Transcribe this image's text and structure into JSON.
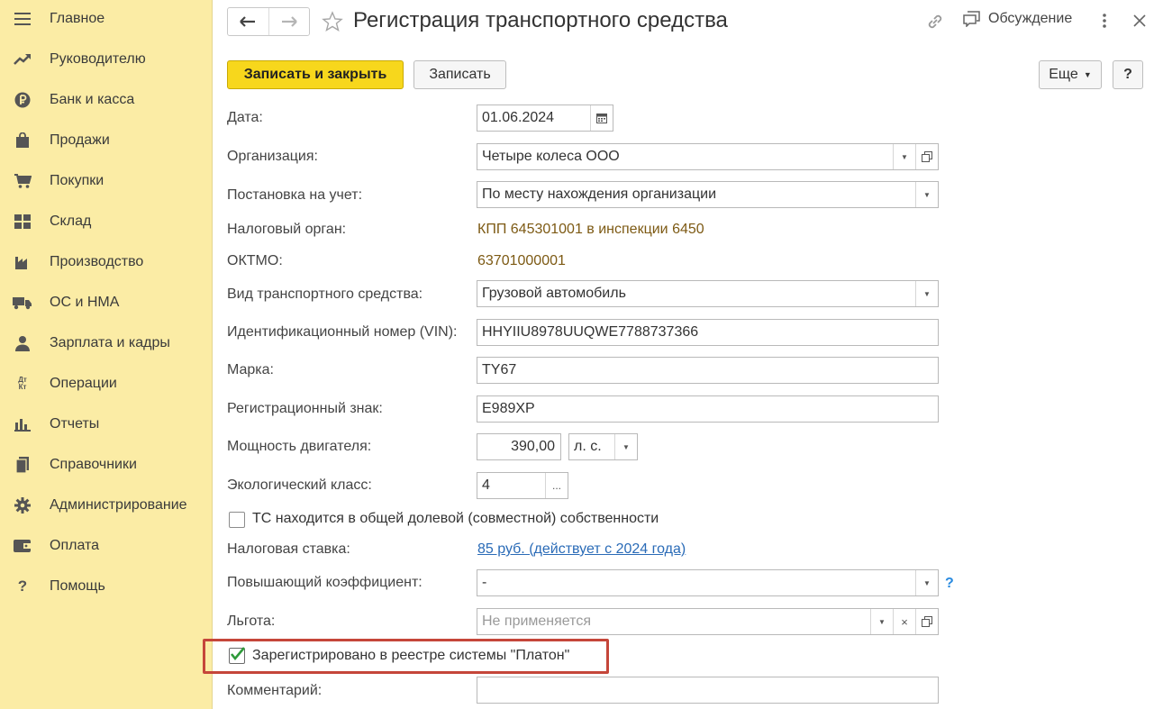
{
  "sidebar": {
    "items": [
      {
        "label": "Главное",
        "icon": "menu-icon"
      },
      {
        "label": "Руководителю",
        "icon": "trend-up-icon"
      },
      {
        "label": "Банк и касса",
        "icon": "ruble-coin-icon"
      },
      {
        "label": "Продажи",
        "icon": "shopping-bag-icon"
      },
      {
        "label": "Покупки",
        "icon": "cart-icon"
      },
      {
        "label": "Склад",
        "icon": "warehouse-grid-icon"
      },
      {
        "label": "Производство",
        "icon": "factory-icon"
      },
      {
        "label": "ОС и НМА",
        "icon": "truck-icon"
      },
      {
        "label": "Зарплата и кадры",
        "icon": "person-icon"
      },
      {
        "label": "Операции",
        "icon": "debit-credit-icon"
      },
      {
        "label": "Отчеты",
        "icon": "bar-chart-icon"
      },
      {
        "label": "Справочники",
        "icon": "books-icon"
      },
      {
        "label": "Администрирование",
        "icon": "gear-icon"
      },
      {
        "label": "Оплата",
        "icon": "wallet-icon"
      },
      {
        "label": "Помощь",
        "icon": "question-icon"
      }
    ],
    "debit_credit_glyph": "Дт Кт",
    "question_glyph": "?"
  },
  "header": {
    "title": "Регистрация транспортного средства",
    "discuss_label": "Обсуждение"
  },
  "toolbar": {
    "save_close_label": "Записать и закрыть",
    "save_label": "Записать",
    "more_label": "Еще",
    "help_label": "?"
  },
  "form": {
    "date": {
      "label": "Дата:",
      "value": "01.06.2024"
    },
    "organization": {
      "label": "Организация:",
      "value": "Четыре колеса ООО"
    },
    "registration": {
      "label": "Постановка на учет:",
      "value": "По месту нахождения организации"
    },
    "tax_authority": {
      "label": "Налоговый орган:",
      "value": "КПП 645301001 в инспекции 6450"
    },
    "oktmo": {
      "label": "ОКТМО:",
      "value": "63701000001"
    },
    "vehicle_type": {
      "label": "Вид транспортного средства:",
      "value": "Грузовой автомобиль"
    },
    "vin": {
      "label": "Идентификационный номер (VIN):",
      "value": "HHYIIU8978UUQWE7788737366"
    },
    "brand": {
      "label": "Марка:",
      "value": "TY67"
    },
    "reg_plate": {
      "label": "Регистрационный знак:",
      "value": "Е989ХР"
    },
    "engine_power": {
      "label": "Мощность двигателя:",
      "value": "390,00",
      "unit": "л. с."
    },
    "eco_class": {
      "label": "Экологический класс:",
      "value": "4",
      "button": "..."
    },
    "shared_ownership": {
      "label": "ТС находится в общей долевой (совместной) собственности",
      "checked": false
    },
    "tax_rate": {
      "label": "Налоговая ставка:",
      "value": "85 руб. (действует с 2024 года)"
    },
    "coefficient": {
      "label": "Повышающий коэффициент:",
      "value": "-",
      "help": "?"
    },
    "benefit": {
      "label": "Льгота:",
      "placeholder": "Не применяется"
    },
    "platon": {
      "label": "Зарегистрировано в реестре системы \"Платон\"",
      "checked": true
    },
    "comment": {
      "label": "Комментарий:",
      "value": ""
    }
  },
  "colors": {
    "sidebar_bg": "#fbeca5",
    "primary_button": "#f7d71c",
    "highlight_border": "#c5463a",
    "link": "#2a6bb7",
    "brown_value": "#7d5a14"
  }
}
